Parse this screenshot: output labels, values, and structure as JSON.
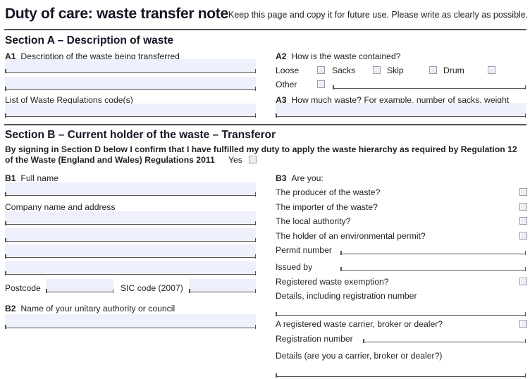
{
  "header": {
    "title": "Duty of care: waste transfer note",
    "subtitle": "Keep this page and copy it for future use. Please write as clearly as possible."
  },
  "section_a": {
    "heading": "Section A – Description of waste",
    "a1": {
      "num": "A1",
      "label": "Description of the waste being transferred",
      "line1": "",
      "line2": ""
    },
    "codes": {
      "label": "List of  Waste Regulations code(s)",
      "value": ""
    },
    "a2": {
      "num": "A2",
      "label": "How is the waste contained?",
      "options": [
        {
          "label": "Loose",
          "checked": false
        },
        {
          "label": "Sacks",
          "checked": false
        },
        {
          "label": "Skip",
          "checked": false
        },
        {
          "label": "Drum",
          "checked": false
        },
        {
          "label": "Other",
          "checked": false
        }
      ],
      "other_value": ""
    },
    "a3": {
      "num": "A3",
      "label": "How much waste? For example, number of sacks, weight",
      "value": ""
    }
  },
  "section_b": {
    "heading": "Section B – Current holder of the waste – Transferor",
    "declaration_line1": "By signing in Section D below I confirm that I have fulfilled my duty to apply the waste hierarchy as required by Regulation 12",
    "declaration_line2": "of the Waste (England and Wales) Regulations 2011",
    "yes_label": "Yes",
    "yes_checked": false,
    "b1": {
      "num": "B1",
      "label": "Full name",
      "value": ""
    },
    "company": {
      "label": "Company name and address",
      "lines": [
        "",
        "",
        "",
        ""
      ]
    },
    "postcode": {
      "label": "Postcode",
      "value": ""
    },
    "sic": {
      "label": "SIC code (2007)",
      "value": ""
    },
    "b2": {
      "num": "B2",
      "label": "Name of your unitary authority or council",
      "value": ""
    },
    "b3": {
      "num": "B3",
      "label": "Are you:",
      "producer": {
        "label": "The producer of the waste?",
        "checked": false
      },
      "importer": {
        "label": "The importer of the waste?",
        "checked": false
      },
      "local_authority": {
        "label": "The local authority?",
        "checked": false
      },
      "permit_holder": {
        "label": "The holder of an environmental permit?",
        "checked": false
      },
      "permit_number": {
        "label": "Permit number",
        "value": ""
      },
      "issued_by": {
        "label": "Issued by",
        "value": ""
      },
      "exemption": {
        "label": "Registered waste exemption?",
        "checked": false
      },
      "exemption_details": {
        "label": "Details, including registration number",
        "value": ""
      },
      "carrier": {
        "label": "A registered waste carrier, broker or dealer?",
        "checked": false
      },
      "registration_number": {
        "label": "Registration number",
        "value": ""
      },
      "carrier_details": {
        "label": "Details (are you a carrier, broker or dealer?)",
        "value": ""
      }
    }
  }
}
